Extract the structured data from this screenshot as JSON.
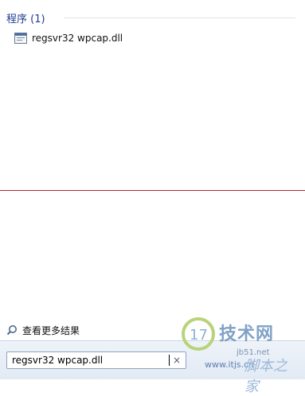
{
  "results": {
    "header": "程序 (1)",
    "items": [
      {
        "label": "regsvr32 wpcap.dll",
        "icon": "program-icon"
      }
    ]
  },
  "see_more": {
    "label": "查看更多结果",
    "icon": "search-icon"
  },
  "search": {
    "value": "regsvr32 wpcap.dll",
    "clear_label": "×"
  },
  "watermark": {
    "brand": "技术网",
    "domain_top": "jb51.net",
    "domain_bottom": "www.itjs.cn",
    "site_name": "脚本之家"
  },
  "colors": {
    "header": "#1e3d8f",
    "divider": "#b52a2a",
    "watermark": "#7fa2c6"
  }
}
